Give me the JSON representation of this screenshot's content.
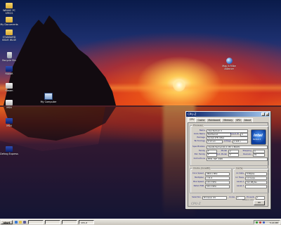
{
  "desktop": {
    "icons": [
      {
        "label": "WINXIE PC SPECS",
        "kind": "folder"
      },
      {
        "label": "My Documents",
        "kind": "folder"
      },
      {
        "label": "STANDARD ISSUE WLSE",
        "kind": "folder"
      },
      {
        "label": "Recycle Bin",
        "kind": "bin"
      },
      {
        "label": "RiAlaR",
        "kind": "app"
      },
      {
        "label": "Steam",
        "kind": "app2"
      },
      {
        "label": "MSN",
        "kind": "app"
      },
      {
        "label": "Defrag Express",
        "kind": "app2"
      },
      {
        "label": "My Computer",
        "kind": "pc"
      },
      {
        "label": "Map It Mike Alliance",
        "kind": "globe"
      }
    ]
  },
  "cpuz": {
    "title": "CPU-Z",
    "tabs": [
      "CPU",
      "Cache",
      "Mainboard",
      "Memory",
      "SPD",
      "About"
    ],
    "processor": {
      "group_label": "Processor",
      "name_label": "Name",
      "name": "Intel Pentium 4",
      "codename_label": "Code Name",
      "codename": "Northwood",
      "brandid_label": "Brand ID",
      "brandid": "9",
      "package_label": "Package",
      "package": "Socket 478 mPGA",
      "technology_label": "Technology",
      "technology": "0.13 um",
      "voltage_label": "Voltage",
      "voltage": "1.525 v",
      "spec_label": "Specification",
      "spec": "Intel(R) Pentium(R) 4 CPU 2.80GHz",
      "family_label": "Family",
      "family": "F",
      "model_label": "Model",
      "model": "2",
      "stepping_label": "Stepping",
      "stepping": "9",
      "extfamily_label": "Ext. Family",
      "extfamily": "F",
      "extmodel_label": "Ext. Model",
      "extmodel": "2",
      "revision_label": "Revision",
      "revision": "D1",
      "instructions_label": "Instructions",
      "instructions": "MMX, SSE, SSE2"
    },
    "clocks": {
      "group_label": "Clocks (Core#0)",
      "core_speed_label": "Core Speed",
      "core_speed": "2800.1 MHz",
      "multiplier_label": "Multiplier",
      "multiplier": "x 21.0",
      "bus_speed_label": "Bus Speed",
      "bus_speed": "133.3 MHz",
      "rated_fsb_label": "Rated FSB",
      "rated_fsb": "533.3 MHz"
    },
    "cache": {
      "group_label": "Cache",
      "l1_data_label": "L1 Data",
      "l1_data": "8 KBytes",
      "l1_trace_label": "L1 Trace",
      "l1_trace": "12 Kuops",
      "level2_label": "Level 2",
      "level2": "512 KBytes",
      "level3_label": "Level 3",
      "level3": ""
    },
    "selection": {
      "label": "Selection",
      "value": "Processor #1",
      "cores_label": "Cores",
      "cores": "1",
      "threads_label": "Threads",
      "threads": "1"
    },
    "version": "Version 1.41",
    "brand": "CPU-Z",
    "ok_label": "OK",
    "logo_text": "intel",
    "logo_sub": "Pentium 4"
  },
  "taskbar": {
    "start_label": "start",
    "tasks": [
      "",
      "",
      "",
      "CPU-Z"
    ],
    "clock": "5:24 PM"
  },
  "colors": {
    "title_bar": "#0a246a",
    "window_face": "#d4d0c8",
    "label_blue": "#1a1a80"
  }
}
